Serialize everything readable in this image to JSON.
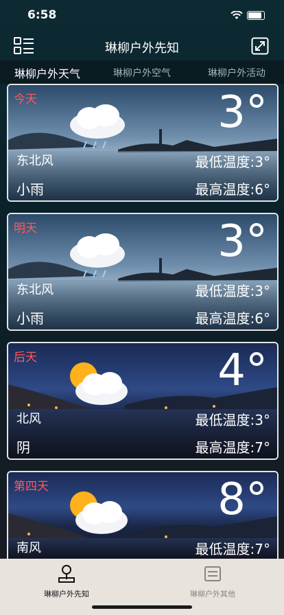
{
  "status": {
    "time": "6:58"
  },
  "header": {
    "title": "琳柳户外先知"
  },
  "tabs": [
    {
      "label": "琳柳户外天气",
      "active": true
    },
    {
      "label": "琳柳户外空气",
      "active": false
    },
    {
      "label": "琳柳户外活动",
      "active": false
    }
  ],
  "cards": [
    {
      "day": "今天",
      "temp": "3°",
      "wind": "东北风",
      "condition": "小雨",
      "low": "最低温度:3°",
      "high": "最高温度:6°",
      "icon": "rain-cloud-icon"
    },
    {
      "day": "明天",
      "temp": "3°",
      "wind": "东北风",
      "condition": "小雨",
      "low": "最低温度:3°",
      "high": "最高温度:6°",
      "icon": "rain-cloud-icon"
    },
    {
      "day": "后天",
      "temp": "4°",
      "wind": "北风",
      "condition": "阴",
      "low": "最低温度:3°",
      "high": "最高温度:7°",
      "icon": "sun-cloud-icon"
    },
    {
      "day": "第四天",
      "temp": "8°",
      "wind": "南风",
      "condition": "",
      "low": "最低温度:7°",
      "high": "",
      "icon": "sun-cloud-icon"
    }
  ],
  "tabbar": [
    {
      "label": "琳柳户外先知",
      "active": true
    },
    {
      "label": "琳柳户外其他",
      "active": false
    }
  ],
  "colors": {
    "day_label": "#ff5a5a",
    "tabbar_bg": "#e9e3de"
  }
}
